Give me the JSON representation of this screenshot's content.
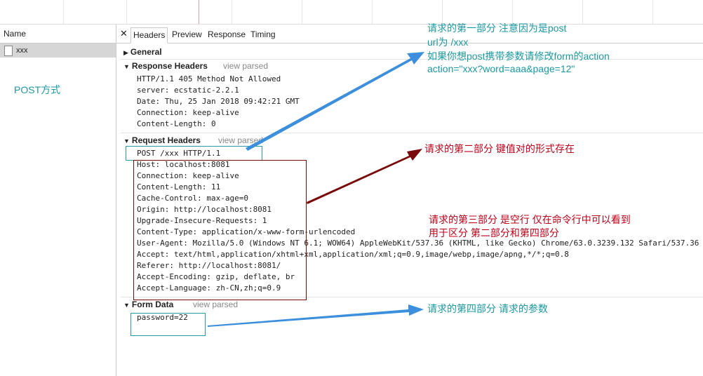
{
  "left_pane": {
    "name_header": "Name",
    "request_name": "xxx",
    "post_label": "POST方式"
  },
  "tabs": [
    "Headers",
    "Preview",
    "Response",
    "Timing"
  ],
  "sections": {
    "general": "General",
    "response_headers": "Response Headers",
    "request_headers": "Request Headers",
    "form_data": "Form Data",
    "view_parsed": "view parsed"
  },
  "response_headers": [
    "HTTP/1.1 405 Method Not Allowed",
    "server: ecstatic-2.2.1",
    "Date: Thu, 25 Jan 2018 09:42:21 GMT",
    "Connection: keep-alive",
    "Content-Length: 0"
  ],
  "request_line": "POST /xxx HTTP/1.1",
  "request_headers": [
    "Host: localhost:8081",
    "Connection: keep-alive",
    "Content-Length: 11",
    "Cache-Control: max-age=0",
    "Origin: http://localhost:8081",
    "Upgrade-Insecure-Requests: 1",
    "Content-Type: application/x-www-form-urlencoded",
    "User-Agent: Mozilla/5.0 (Windows NT 6.1; WOW64) AppleWebKit/537.36 (KHTML, like Gecko) Chrome/63.0.3239.132 Safari/537.36",
    "Accept: text/html,application/xhtml+xml,application/xml;q=0.9,image/webp,image/apng,*/*;q=0.8",
    "Referer: http://localhost:8081/",
    "Accept-Encoding: gzip, deflate, br",
    "Accept-Language: zh-CN,zh;q=0.9"
  ],
  "form_data": "password=22",
  "annotations": {
    "part1": [
      "请求的第一部分 注意因为是post",
      "url为   /xxx",
      "如果你想post携带参数请修改form的action",
      "action=\"xxx?word=aaa&page=12\""
    ],
    "part2": "请求的第二部分  键值对的形式存在",
    "part3": [
      "请求的第三部分 是空行  仅在命令行中可以看到",
      "用于区分 第二部分和第四部分"
    ],
    "part4": "请求的第四部分  请求的参数"
  },
  "colors": {
    "annotation_teal": "#1a9aa0",
    "annotation_red": "#c0001a",
    "arrow_blue": "#3b8fdc",
    "arrow_darkred": "#7a0a0a",
    "box_teal": "#2a9aa8"
  }
}
